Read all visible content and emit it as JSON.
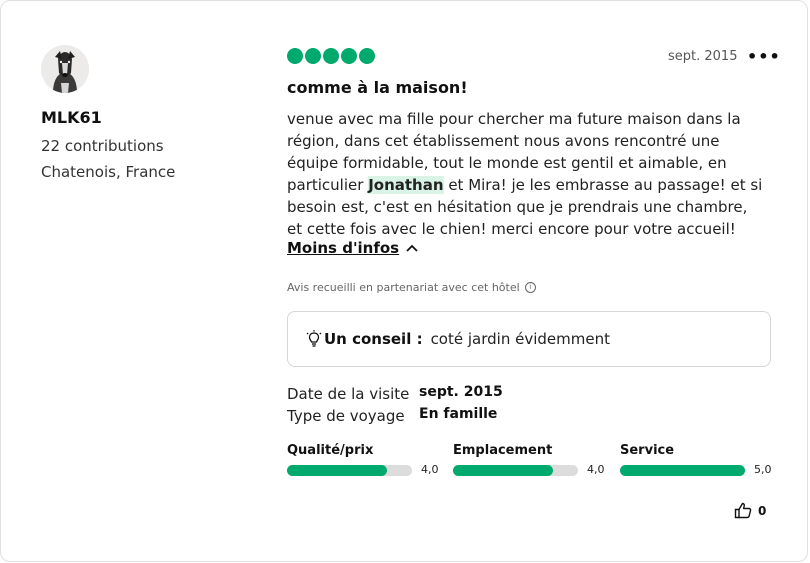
{
  "user": {
    "name": "MLK61",
    "contributions": "22 contributions",
    "location": "Chatenois, France"
  },
  "review": {
    "rating": 5,
    "rating_max": 5,
    "date": "sept. 2015",
    "menu": "•••",
    "title": "comme à la maison!",
    "body_line1": "venue avec ma fille pour chercher ma future maison dans la région, dans cet établissement nous avons rencontré une équipe formidable, tout le monde est gentil et aimable, en particulier",
    "body_highlight": "Jonathan",
    "body_line2": " et Mira! je les embrasse au passage! et si besoin est, c'est en hésitation que je prendrais une chambre, et cette fois avec le chien! merci encore pour votre accueil!",
    "less_info": "Moins d'infos",
    "partner_note": "Avis recueilli en partenariat avec cet hôtel",
    "tip_label": "Un conseil :",
    "tip_text": "coté jardin évidemment"
  },
  "visit": {
    "date_label": "Date de la visite",
    "date_value": "sept. 2015",
    "type_label": "Type de voyage",
    "type_value": "En famille"
  },
  "sub_ratings": [
    {
      "label": "Qualité/prix",
      "value": "4,0",
      "fraction": 0.8
    },
    {
      "label": "Emplacement",
      "value": "4,0",
      "fraction": 0.8
    },
    {
      "label": "Service",
      "value": "5,0",
      "fraction": 1.0
    }
  ],
  "helpful": {
    "count": "0"
  },
  "colors": {
    "accent": "#00aa6c",
    "highlight": "#d9f3e6",
    "track": "#dcdcdc"
  },
  "icons": {
    "avatar": "dog-avatar",
    "menu": "more-options-icon",
    "chevron": "chevron-up-icon",
    "info": "info-icon",
    "tip": "lightbulb-icon",
    "helpful": "thumbs-up-icon"
  }
}
